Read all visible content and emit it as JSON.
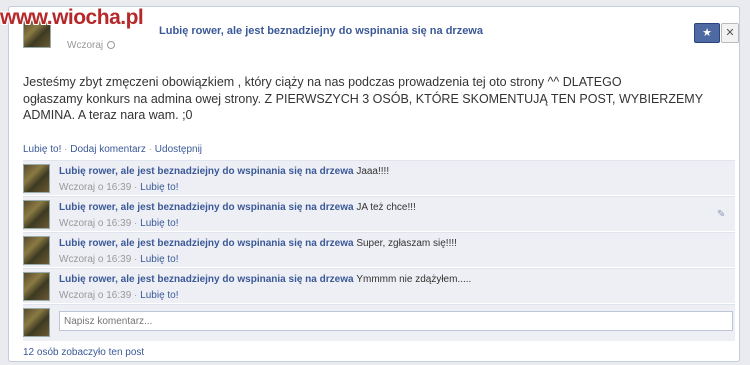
{
  "watermark": {
    "www": "www.",
    "wiocha": "wiocha",
    "pl": ".pl"
  },
  "post": {
    "page_name": "Lubię rower, ale jest beznadziejny do wspinania się na drzewa",
    "time": "Wczoraj",
    "body_line1": "Jesteśmy zbyt zmęczeni obowiązkiem , który ciąży na nas podczas prowadzenia tej oto strony ^^ DLATEGO",
    "body_line2": "ogłaszamy konkurs na admina owej strony. Z PIERWSZYCH 3 OSÓB, KTÓRE SKOMENTUJĄ TEN POST, WYBIERZEMY",
    "body_line3": "ADMINA. A teraz nara wam. ;0"
  },
  "header_buttons": {
    "star": "★",
    "close": "✕"
  },
  "actions": {
    "like": "Lubię to!",
    "comment": "Dodaj komentarz",
    "share": "Udostępnij",
    "sep": "·"
  },
  "comments": [
    {
      "author": "Lubię rower, ale jest beznadziejny do wspinania się na drzewa",
      "text": "Jaaa!!!!",
      "time": "Wczoraj o 16:39",
      "like": "Lubię to!"
    },
    {
      "author": "Lubię rower, ale jest beznadziejny do wspinania się na drzewa",
      "text": "JA też chce!!!",
      "time": "Wczoraj o 16:39",
      "like": "Lubię to!"
    },
    {
      "author": "Lubię rower, ale jest beznadziejny do wspinania się na drzewa",
      "text": "Super, zgłaszam się!!!!",
      "time": "Wczoraj o 16:39",
      "like": "Lubię to!"
    },
    {
      "author": "Lubię rower, ale jest beznadziejny do wspinania się na drzewa",
      "text": "Ymmmm nie zdążyłem.....",
      "time": "Wczoraj o 16:39",
      "like": "Lubię to!"
    }
  ],
  "comment_input": {
    "placeholder": "Napisz komentarz..."
  },
  "seen": "12 osób zobaczyło ten post",
  "colors": {
    "link": "#3b5998",
    "watermark": "#b6282a",
    "comment_bg": "#edeff4"
  }
}
